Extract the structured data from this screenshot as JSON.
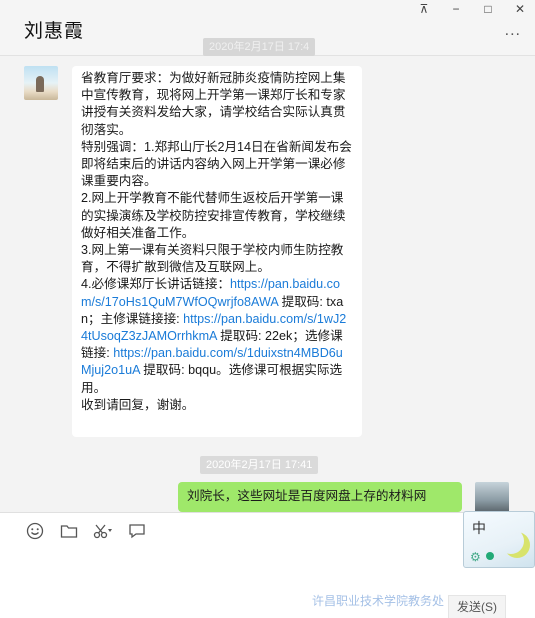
{
  "header": {
    "contact_name": "刘惠霞",
    "more_icon": "..."
  },
  "window_controls": {
    "pin": "⊼",
    "minimize": "−",
    "maximize": "□",
    "close": "✕"
  },
  "messages": {
    "timestamp_top": "2020年2月17日 17:4",
    "incoming": {
      "paragraphs": [
        "省教育厅要求：为做好新冠肺炎疫情防控网上集中宣传教育，现将网上开学第一课郑厅长和专家讲授有关资料发给大家，请学校结合实际认真贯彻落实。",
        "特别强调：1.郑邦山厅长2月14日在省新闻发布会即将结束后的讲话内容纳入网上开学第一课必修课重要内容。",
        "2.网上开学教育不能代替师生返校后开学第一课的实操演练及学校防控安排宣传教育，学校继续做好相关准备工作。",
        "3.网上第一课有关资料只限于学校内师生防控教育，不得扩散到微信及互联网上。"
      ],
      "links_block": {
        "p1": "4.必修课郑厅长讲话链接：",
        "link1": "https://pan.baidu.com/s/17oHs1QuM7WfOQwrjfo8AWA",
        "p2": " 提取码: txan；主修课链接接: ",
        "link2": "https://pan.baidu.com/s/1wJ24tUsoqZ3zJAMOrrhkmA",
        "p3": " 提取码: 22ek；选修课链接: ",
        "link3": "https://pan.baidu.com/s/1duixstn4MBD6uMjuj2o1uA",
        "p4": " 提取码: bqqu。选修课可根据实际选用。"
      },
      "closing": "收到请回复，谢谢。"
    },
    "timestamp_mid": "2020年2月17日 17:41",
    "outgoing_preview": "刘院长，这些网址是百度网盘上存的材料网"
  },
  "composer": {
    "send_label": "发送(S)"
  },
  "ime": {
    "mode_label": "中"
  },
  "watermark": "许昌职业技术学院教务处"
}
